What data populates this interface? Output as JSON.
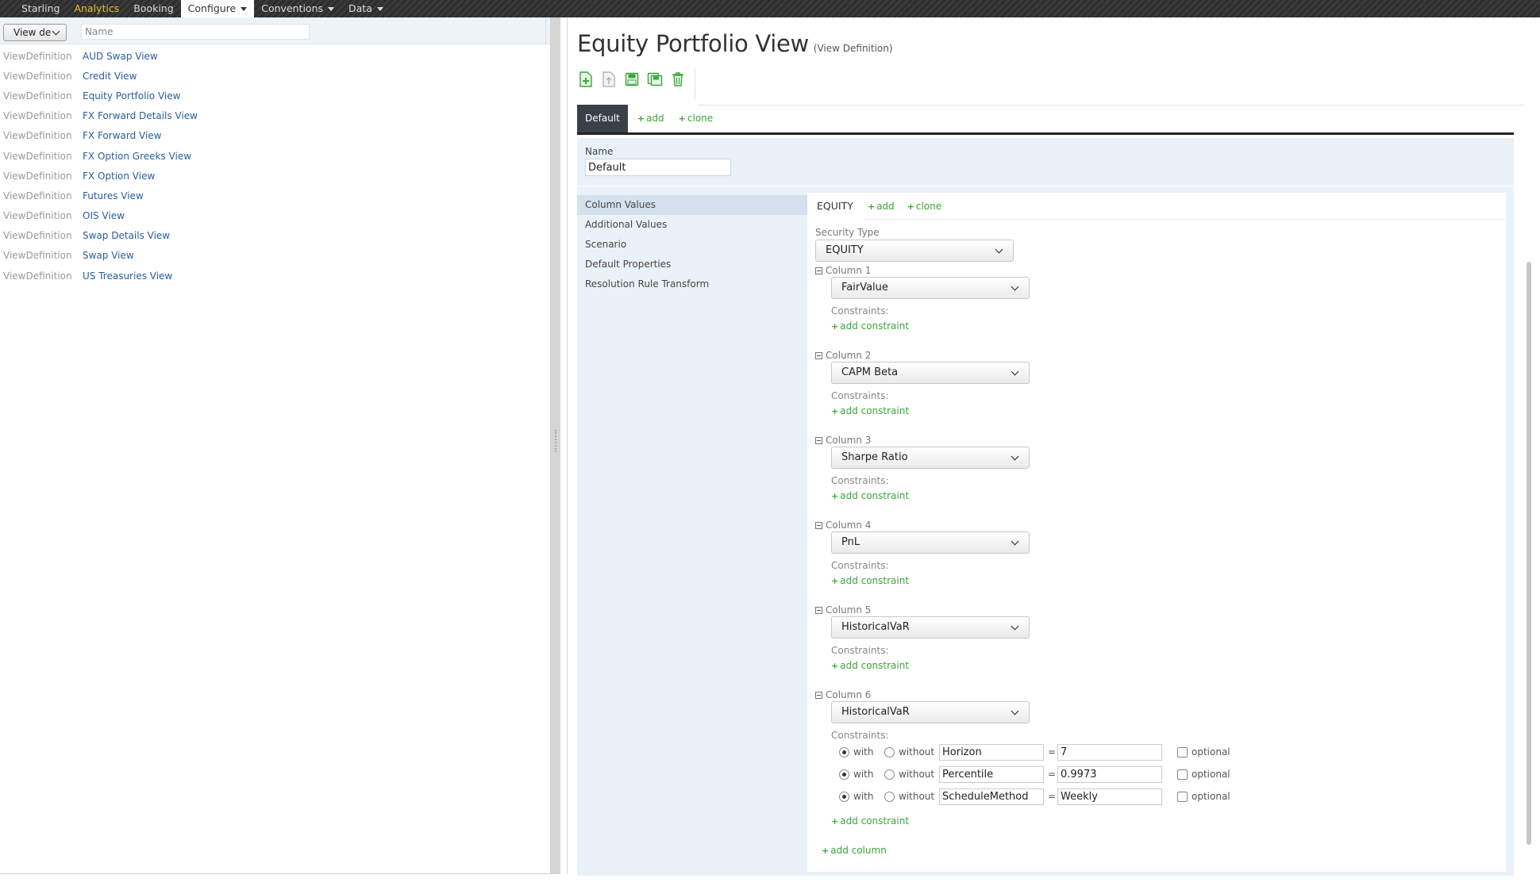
{
  "nav": {
    "items": [
      {
        "label": "Starling"
      },
      {
        "label": "Analytics"
      },
      {
        "label": "Booking"
      },
      {
        "label": "Configure"
      },
      {
        "label": "Conventions"
      },
      {
        "label": "Data"
      }
    ],
    "highlight_color": "#e6c229"
  },
  "left": {
    "view_select": "View de",
    "name_placeholder": "Name",
    "rows": [
      {
        "type": "ViewDefinition",
        "name": "AUD Swap View"
      },
      {
        "type": "ViewDefinition",
        "name": "Credit View"
      },
      {
        "type": "ViewDefinition",
        "name": "Equity Portfolio View"
      },
      {
        "type": "ViewDefinition",
        "name": "FX Forward Details View"
      },
      {
        "type": "ViewDefinition",
        "name": "FX Forward View"
      },
      {
        "type": "ViewDefinition",
        "name": "FX Option Greeks View"
      },
      {
        "type": "ViewDefinition",
        "name": "FX Option View"
      },
      {
        "type": "ViewDefinition",
        "name": "Futures View"
      },
      {
        "type": "ViewDefinition",
        "name": "OIS View"
      },
      {
        "type": "ViewDefinition",
        "name": "Swap Details View"
      },
      {
        "type": "ViewDefinition",
        "name": "Swap View"
      },
      {
        "type": "ViewDefinition",
        "name": "US Treasuries View"
      }
    ]
  },
  "right": {
    "title": "Equity Portfolio View",
    "subtitle": "(View Definition)",
    "toolbar_icons": [
      "new-icon",
      "upload-icon",
      "save-icon",
      "save-as-icon",
      "delete-icon"
    ],
    "tabs": {
      "default": "Default",
      "add": "add",
      "clone": "clone"
    },
    "name_label": "Name",
    "name_value": "Default",
    "side_menu": [
      "Column Values",
      "Additional Values",
      "Scenario",
      "Default Properties",
      "Resolution Rule Transform"
    ],
    "security_tabs": {
      "current": "EQUITY",
      "add": "add",
      "clone": "clone"
    },
    "security_type_label": "Security Type",
    "security_type_value": "EQUITY",
    "constraints_label": "Constraints:",
    "add_constraint": "add constraint",
    "add_column": "add column",
    "columns": [
      {
        "label": "Column 1",
        "value": "FairValue"
      },
      {
        "label": "Column 2",
        "value": "CAPM Beta"
      },
      {
        "label": "Column 3",
        "value": "Sharpe Ratio"
      },
      {
        "label": "Column 4",
        "value": "PnL"
      },
      {
        "label": "Column 5",
        "value": "HistoricalVaR"
      },
      {
        "label": "Column 6",
        "value": "HistoricalVaR"
      }
    ],
    "constraint_rows": [
      {
        "with": "with",
        "without": "without",
        "key": "Horizon",
        "eq": "=",
        "value": "7",
        "optional": "optional",
        "selected": "with"
      },
      {
        "with": "with",
        "without": "without",
        "key": "Percentile",
        "eq": "=",
        "value": "0.9973",
        "optional": "optional",
        "selected": "with"
      },
      {
        "with": "with",
        "without": "without",
        "key": "ScheduleMethod",
        "eq": "=",
        "value": "Weekly",
        "optional": "optional",
        "selected": "with"
      }
    ]
  }
}
